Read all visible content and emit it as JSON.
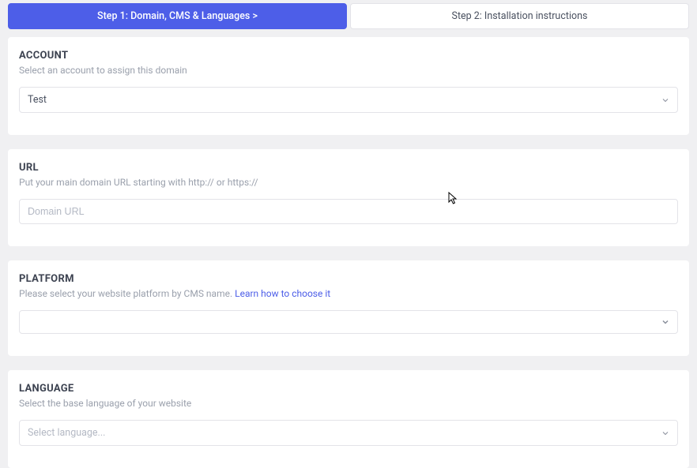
{
  "tabs": {
    "step1": "Step 1: Domain, CMS & Languages  >",
    "step2": "Step 2: Installation instructions"
  },
  "account": {
    "title": "ACCOUNT",
    "desc": "Select an account to assign this domain",
    "value": "Test"
  },
  "url": {
    "title": "URL",
    "desc": "Put your main domain URL starting with http:// or https://",
    "placeholder": "Domain URL"
  },
  "platform": {
    "title": "PLATFORM",
    "desc": "Please select your website platform by CMS name. ",
    "link": "Learn how to choose it",
    "value": ""
  },
  "language": {
    "title": "LANGUAGE",
    "desc": "Select the base language of your website",
    "value": "Select language..."
  }
}
